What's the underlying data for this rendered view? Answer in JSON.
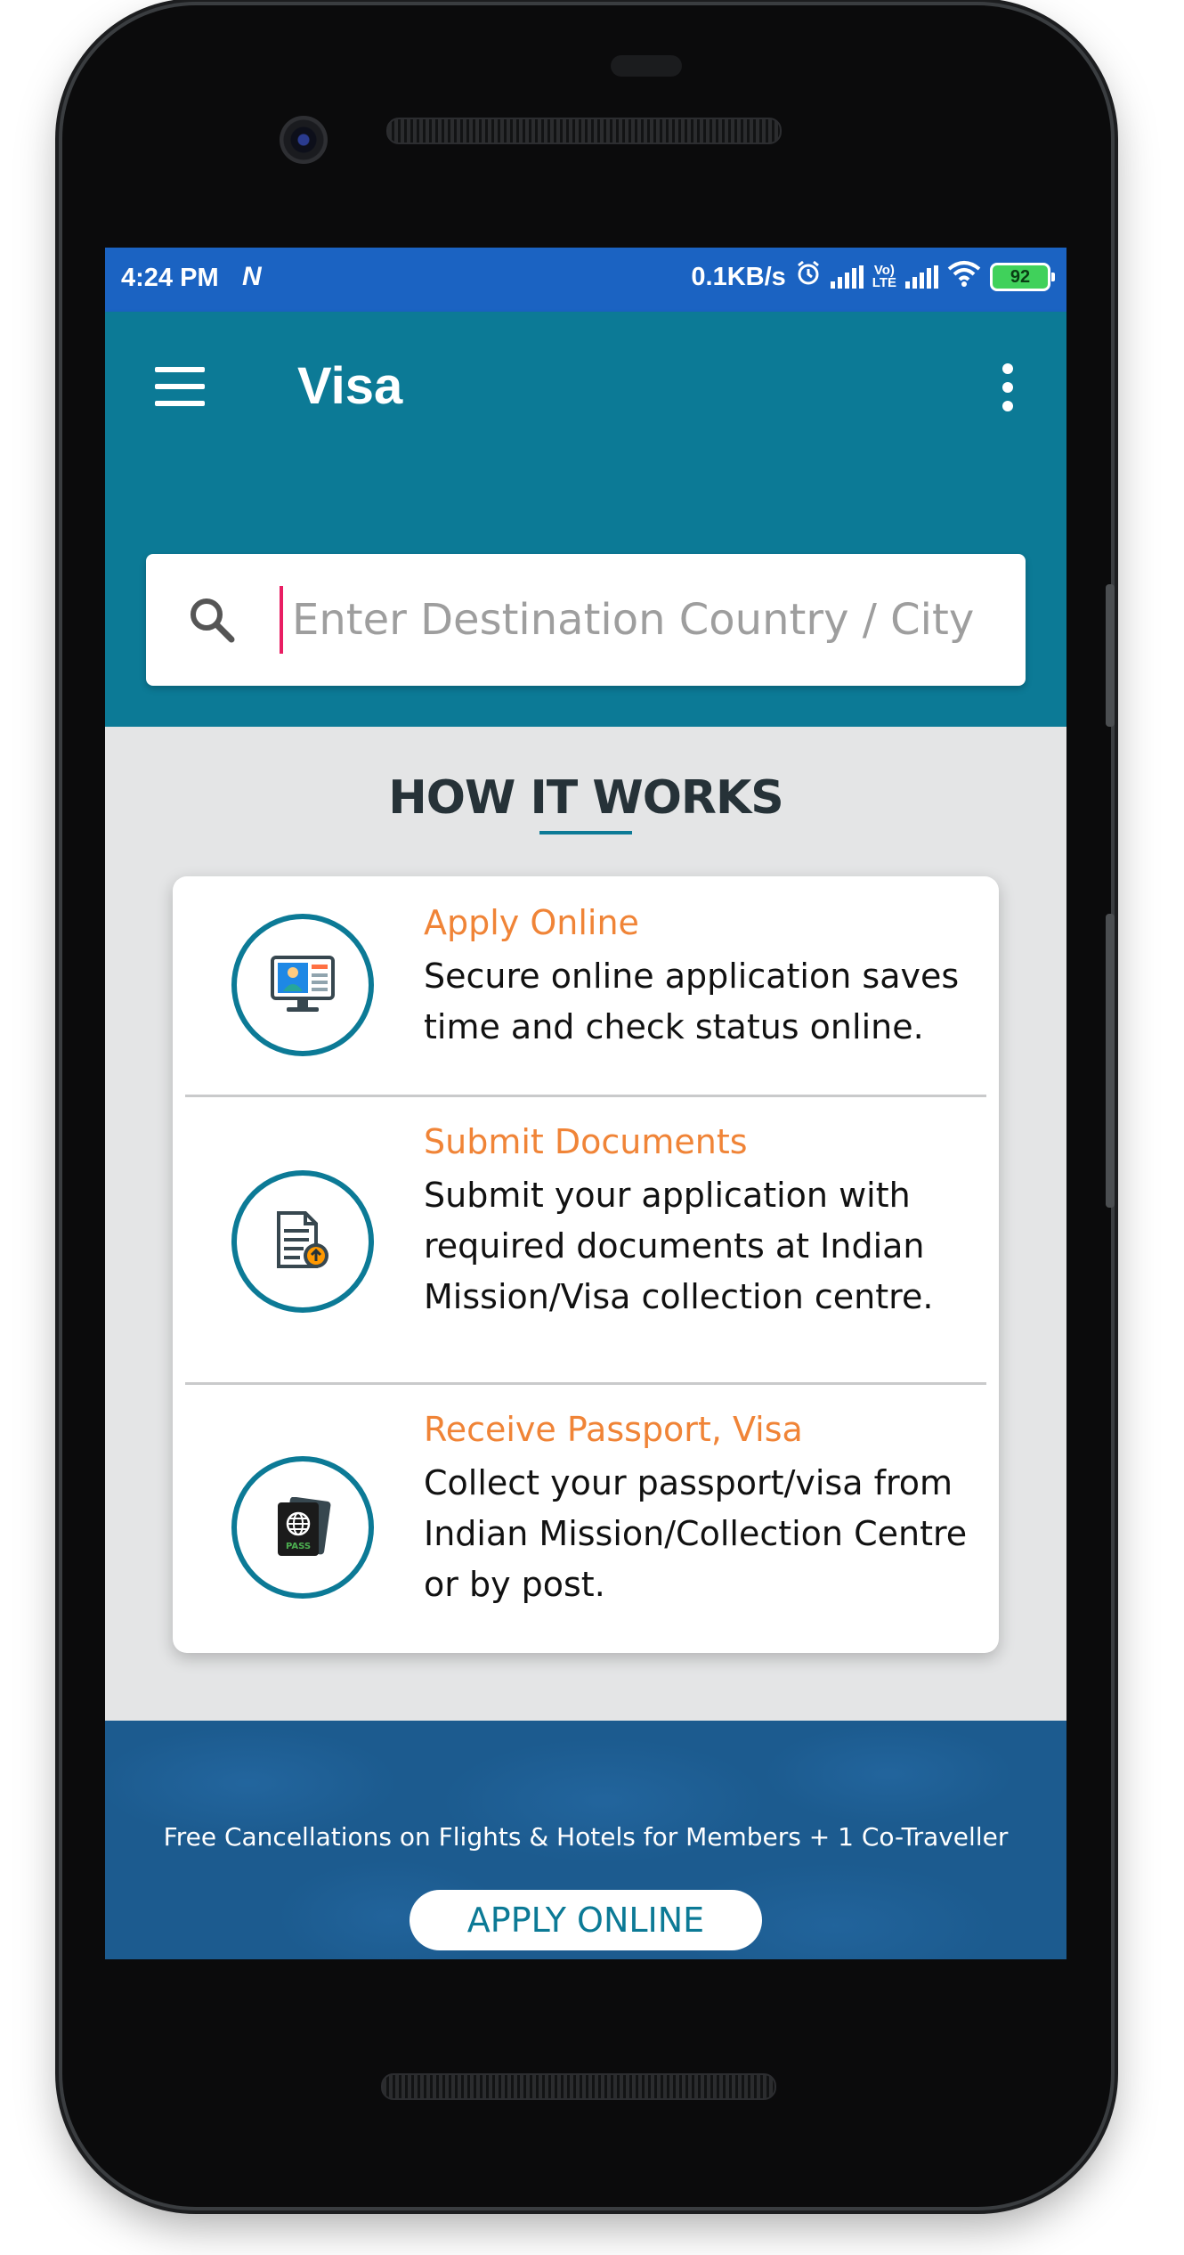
{
  "status_bar": {
    "time": "4:24 PM",
    "notification_icon": "N",
    "network_speed": "0.1KB/s",
    "volte_line1": "Vo)",
    "volte_line2": "LTE",
    "battery": "92"
  },
  "app_bar": {
    "title": "Visa",
    "menu_icon": "hamburger-menu",
    "overflow_icon": "more-vertical"
  },
  "search": {
    "placeholder": "Enter Destination Country / City",
    "value": ""
  },
  "how_it_works": {
    "title": "HOW IT WORKS",
    "steps": [
      {
        "icon": "computer-application-icon",
        "title": "Apply Online",
        "description": "Secure online application saves time and check status online."
      },
      {
        "icon": "document-upload-icon",
        "title": "Submit Documents",
        "description": "Submit your application with required documents at Indian Mission/Visa collection centre."
      },
      {
        "icon": "passport-icon",
        "title": "Receive Passport, Visa",
        "description": "Collect your passport/visa from Indian Mission/Collection Centre or by post.",
        "icon_text": "PASS"
      }
    ]
  },
  "footer": {
    "promo_text": "Free Cancellations on Flights & Hotels for Members + 1 Co-Traveller",
    "apply_button": "APPLY ONLINE"
  },
  "colors": {
    "status_bar": "#1b63c2",
    "primary": "#0c7a96",
    "accent_orange": "#f08437",
    "cursor": "#e91e63",
    "footer": "#1c5b8f"
  }
}
